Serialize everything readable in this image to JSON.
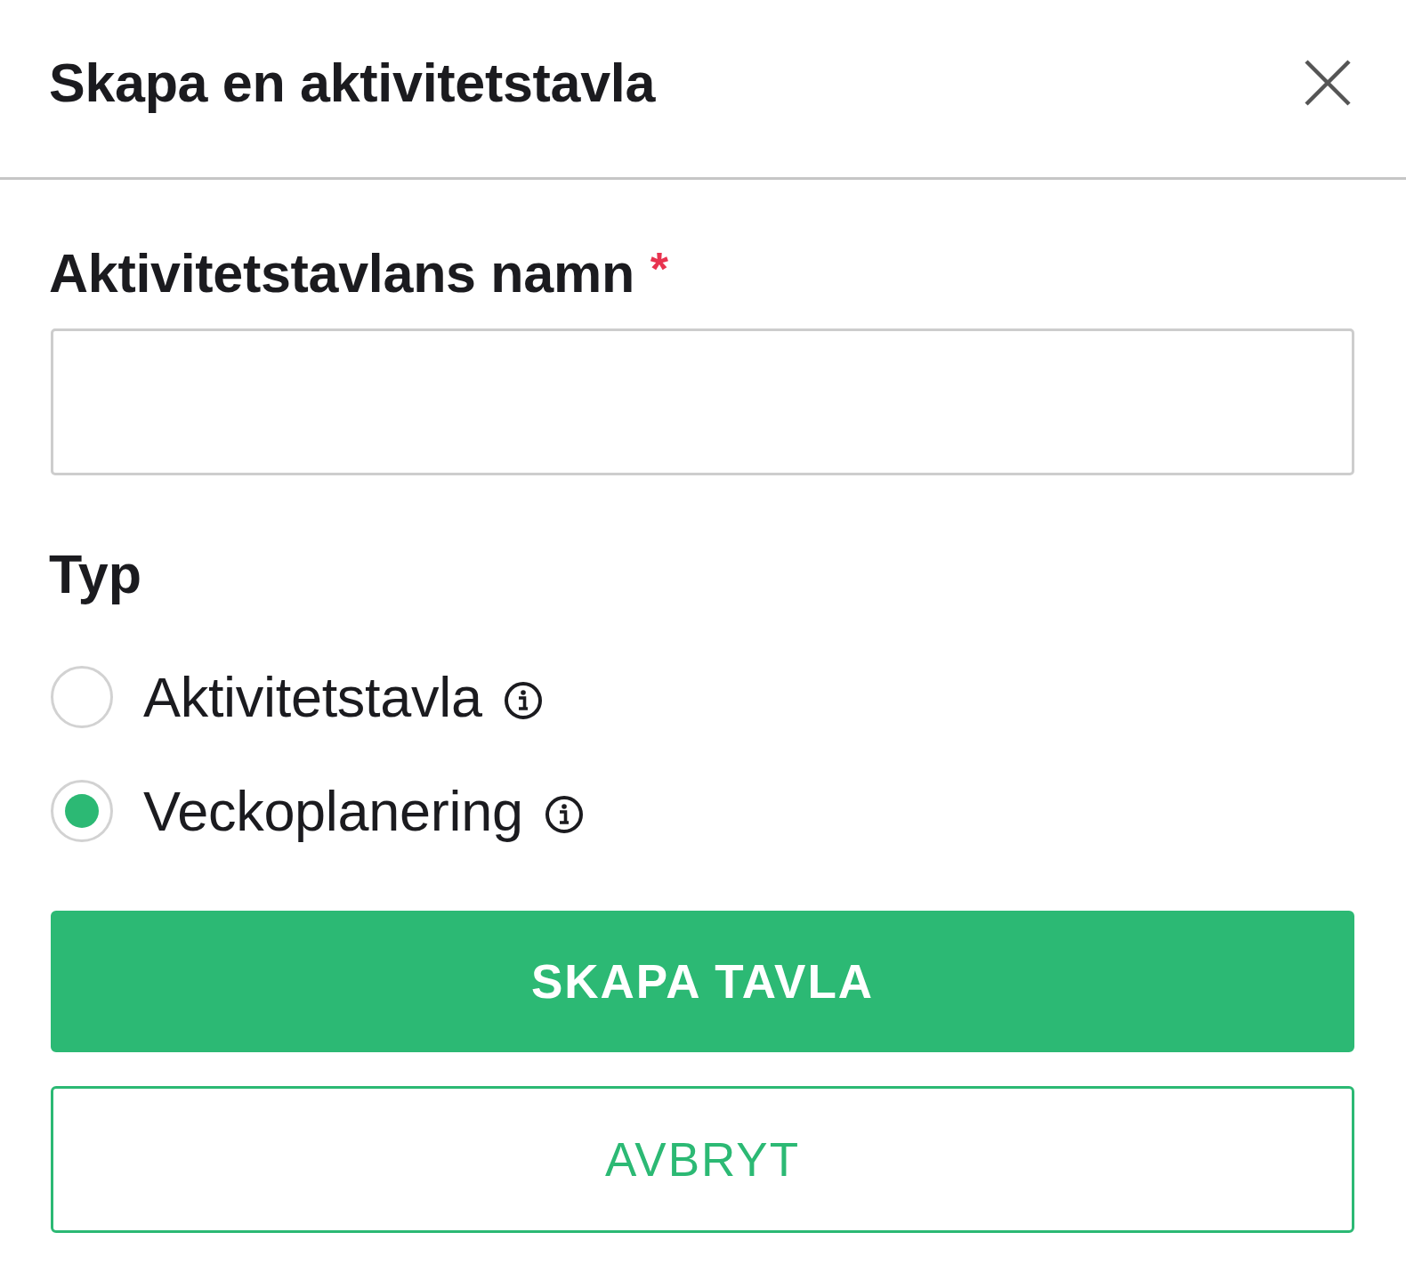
{
  "dialog": {
    "title": "Skapa en aktivitetstavla"
  },
  "name_field": {
    "label": "Aktivitetstavlans namn",
    "required_mark": "*"
  },
  "type_group": {
    "label": "Typ",
    "options": [
      {
        "label": "Aktivitetstavla",
        "selected": false
      },
      {
        "label": "Veckoplanering",
        "selected": true
      }
    ]
  },
  "buttons": [
    {
      "label": "SKAPA TAVLA",
      "kind": "primary"
    },
    {
      "label": "AVBRYT",
      "kind": "secondary"
    }
  ]
}
